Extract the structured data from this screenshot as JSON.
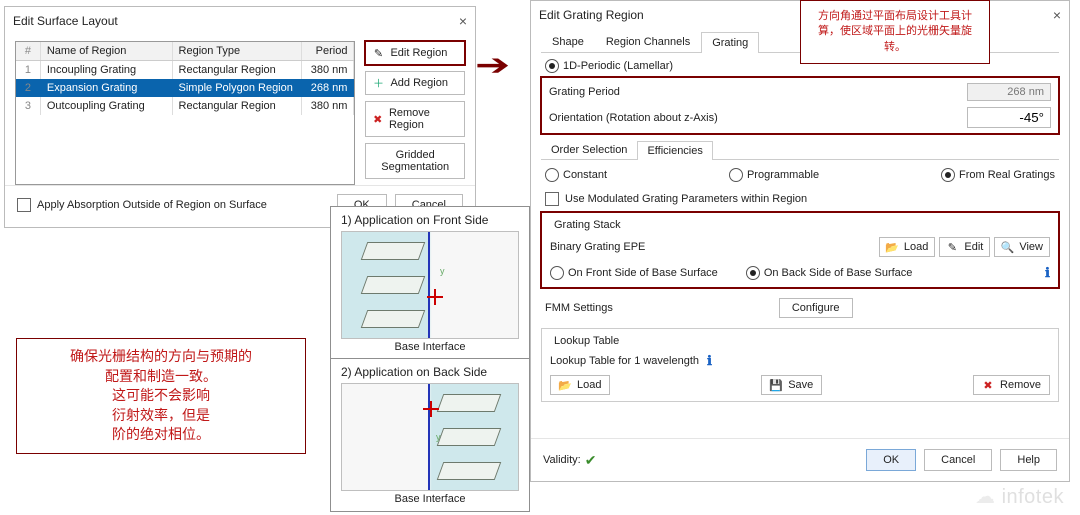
{
  "left": {
    "title": "Edit Surface Layout",
    "cols": [
      "#",
      "Name of Region",
      "Region Type",
      "Period"
    ],
    "rows": [
      {
        "idx": "1",
        "name": "Incoupling Grating",
        "type": "Rectangular Region",
        "period": "380 nm"
      },
      {
        "idx": "2",
        "name": "Expansion Grating",
        "type": "Simple Polygon Region",
        "period": "268 nm"
      },
      {
        "idx": "3",
        "name": "Outcoupling Grating",
        "type": "Rectangular Region",
        "period": "380 nm"
      }
    ],
    "btns": {
      "edit": "Edit Region",
      "add": "Add Region",
      "remove": "Remove Region",
      "seg": "Gridded Segmentation"
    },
    "absorb": "Apply Absorption Outside of Region on Surface",
    "ok": "OK",
    "cancel": "Cancel"
  },
  "right": {
    "title": "Edit Grating Region",
    "tabs": {
      "shape": "Shape",
      "channels": "Region Channels",
      "grating": "Grating"
    },
    "lamellar": "1D-Periodic (Lamellar)",
    "period_label": "Grating Period",
    "period_val": "268 nm",
    "orient_label": "Orientation (Rotation about z-Axis)",
    "orient_val": "-45°",
    "subtabs": {
      "order": "Order Selection",
      "eff": "Efficiencies"
    },
    "eff": {
      "constant": "Constant",
      "prog": "Programmable",
      "real": "From Real Gratings"
    },
    "use_mod": "Use Modulated Grating Parameters within Region",
    "stack": {
      "title": "Grating Stack",
      "name": "Binary Grating EPE",
      "load": "Load",
      "edit": "Edit",
      "view": "View",
      "front": "On Front Side of Base Surface",
      "back": "On Back Side of Base Surface"
    },
    "fmm": "FMM Settings",
    "configure": "Configure",
    "lookup": {
      "title": "Lookup Table",
      "count": "Lookup Table for 1 wavelength",
      "load": "Load",
      "save": "Save",
      "remove": "Remove"
    },
    "validity": "Validity:",
    "ok": "OK",
    "cancel": "Cancel",
    "help": "Help"
  },
  "ill": {
    "front": "1) Application on Front Side",
    "back": "2) Application on Back Side",
    "caption": "Base Interface"
  },
  "anno1": "方向角通过平面布局设计工具计算，使区域平面上的光栅矢量旋转。",
  "anno2": {
    "l1": "确保光栅结构的方向与预期的",
    "l2": "配置和制造一致。",
    "l3": "这可能不会影响",
    "l4": "衍射效率，但是",
    "l5": "阶的绝对相位。"
  },
  "watermark": "infotek"
}
